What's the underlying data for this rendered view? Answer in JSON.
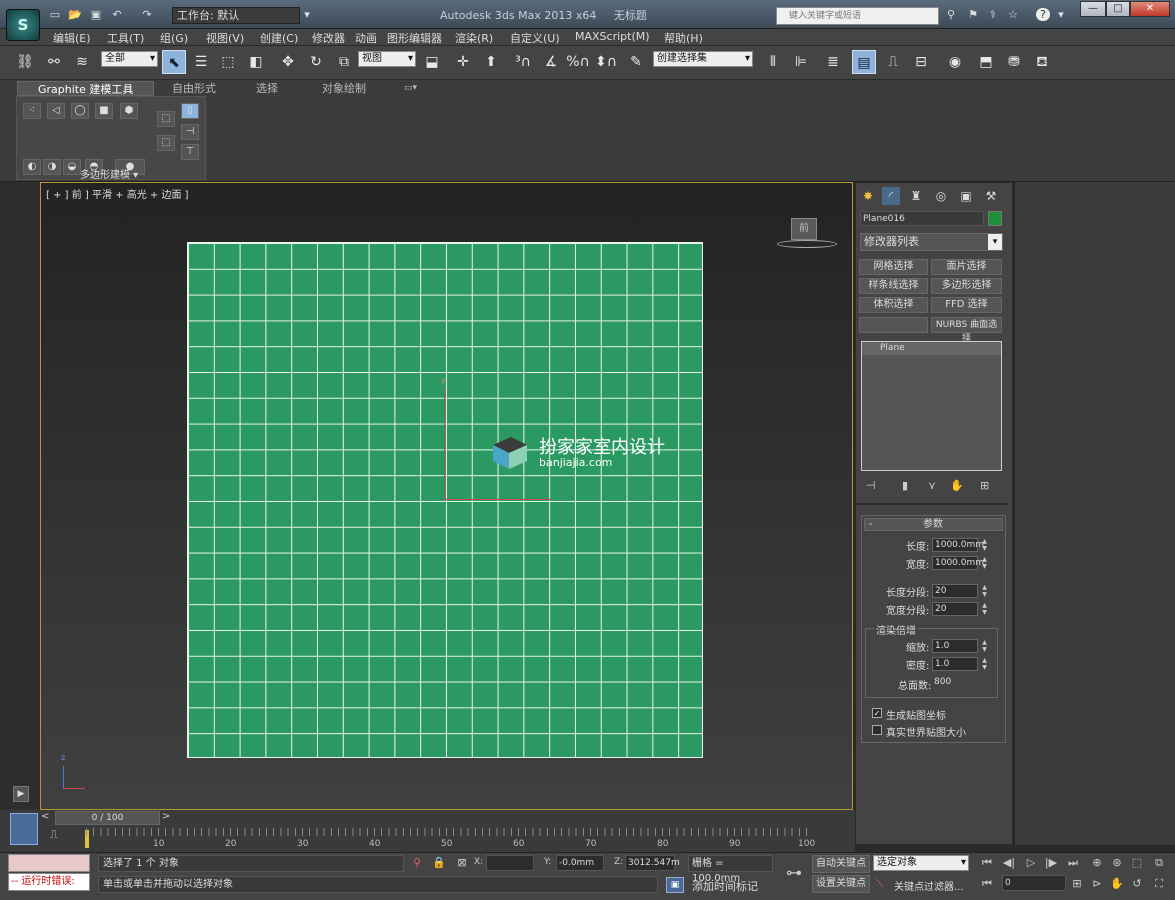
{
  "app": {
    "title": "Autodesk 3ds Max  2013 x64",
    "doc_title": "无标题",
    "workspace": "工作台: 默认",
    "search_placeholder": "键入关键字或短语",
    "logo": "S"
  },
  "menu": [
    "编辑(E)",
    "工具(T)",
    "组(G)",
    "视图(V)",
    "创建(C)",
    "修改器",
    "动画",
    "图形编辑器",
    "渲染(R)",
    "自定义(U)",
    "MAXScript(M)",
    "帮助(H)"
  ],
  "toolbar": {
    "selection_filter": "全部",
    "reference_coord": "视图",
    "named_selection": "创建选择集"
  },
  "ribbon": {
    "tabs": [
      "Graphite 建模工具",
      "自由形式",
      "选择",
      "对象绘制"
    ],
    "panel_label": "多边形建模"
  },
  "viewport": {
    "label": "[ + ] 前 ] 平滑 + 高光 + 边面 ]",
    "viewcube_label": "前",
    "watermark_text": "扮家家室内设计",
    "watermark_url": "banjiajia.com",
    "axis_y": "y",
    "axis_z": "z"
  },
  "command_panel": {
    "object_name": "Plane016",
    "object_color": "#1f8f3a",
    "modifier_list": "修改器列表",
    "modifier_buttons": [
      "网格选择",
      "面片选择",
      "样条线选择",
      "多边形选择",
      "体积选择",
      "FFD 选择",
      "",
      "NURBS 曲面选择"
    ],
    "stack_item": "Plane",
    "rollout_title": "参数",
    "length_label": "长度:",
    "length_value": "1000.0mm",
    "width_label": "宽度:",
    "width_value": "1000.0mm",
    "length_segs_label": "长度分段:",
    "length_segs_value": "20",
    "width_segs_label": "宽度分段:",
    "width_segs_value": "20",
    "render_group": "渲染倍增",
    "scale_label": "缩放:",
    "scale_value": "1.0",
    "density_label": "密度:",
    "density_value": "1.0",
    "total_faces_label": "总面数:",
    "total_faces_value": "800",
    "gen_mapping_label": "生成贴图坐标",
    "real_world_label": "真实世界贴图大小"
  },
  "timeline": {
    "counter": "0 / 100",
    "ticks": [
      "10",
      "20",
      "30",
      "40",
      "50",
      "60",
      "70",
      "80",
      "90",
      "100"
    ]
  },
  "status": {
    "error_label": "-- 运行时错误:",
    "selection_msg": "选择了 1 个 对象",
    "prompt_msg": "单击或单击并拖动以选择对象",
    "x_label": "X:",
    "x_value": "",
    "y_label": "Y:",
    "y_value": "-0.0mm",
    "z_label": "Z:",
    "z_value": "3012.547m",
    "grid_label": "栅格 = 100.0mm",
    "add_time_tag": "添加时间标记",
    "auto_key": "自动关键点",
    "set_key": "设置关键点",
    "key_mode": "选定对象",
    "key_filters": "关键点过滤器...",
    "frame_value": "0"
  }
}
